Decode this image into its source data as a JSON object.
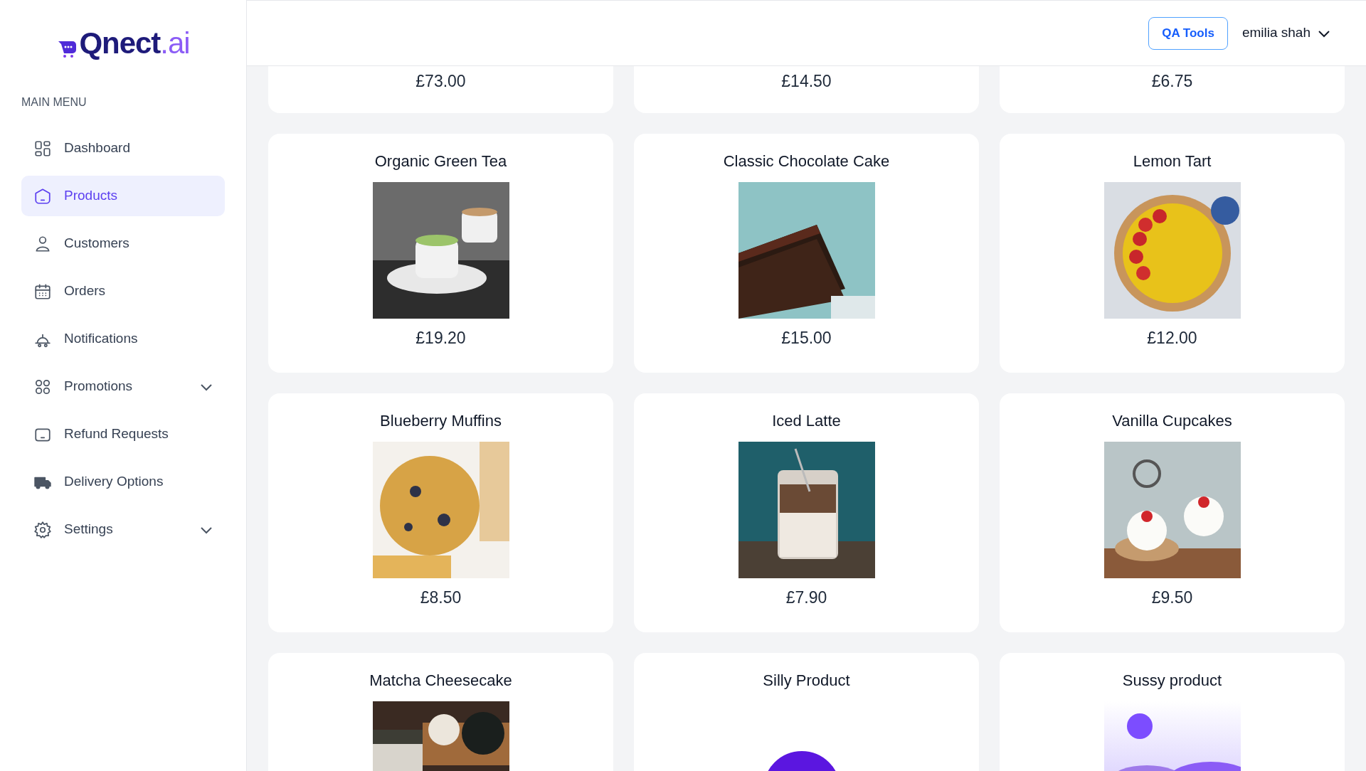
{
  "logo": {
    "text": "Qnect",
    "suffix": ".ai"
  },
  "sidebar": {
    "heading": "MAIN MENU",
    "items": [
      {
        "label": "Dashboard",
        "selected": false,
        "expandable": false
      },
      {
        "label": "Products",
        "selected": true,
        "expandable": false
      },
      {
        "label": "Customers",
        "selected": false,
        "expandable": false
      },
      {
        "label": "Orders",
        "selected": false,
        "expandable": false
      },
      {
        "label": "Notifications",
        "selected": false,
        "expandable": false
      },
      {
        "label": "Promotions",
        "selected": false,
        "expandable": true
      },
      {
        "label": "Refund Requests",
        "selected": false,
        "expandable": false
      },
      {
        "label": "Delivery Options",
        "selected": false,
        "expandable": false
      },
      {
        "label": "Settings",
        "selected": false,
        "expandable": true
      }
    ]
  },
  "header": {
    "button": "QA Tools",
    "user": "emilia shah"
  },
  "products": [
    {
      "price": "£73.00"
    },
    {
      "price": "£14.50"
    },
    {
      "price": "£6.75"
    },
    {
      "name": "Organic Green Tea",
      "kind": "photo",
      "price": "£19.20"
    },
    {
      "name": "Classic Chocolate Cake",
      "kind": "photo",
      "price": "£15.00"
    },
    {
      "name": "Lemon Tart",
      "kind": "photo",
      "price": "£12.00"
    },
    {
      "name": "Blueberry Muffins",
      "kind": "photo",
      "price": "£8.50"
    },
    {
      "name": "Iced Latte",
      "kind": "photo",
      "price": "£7.90"
    },
    {
      "name": "Vanilla Cupcakes",
      "kind": "photo",
      "price": "£9.50"
    },
    {
      "name": "Matcha Cheesecake",
      "kind": "photo"
    },
    {
      "name": "Silly Product",
      "kind": "logo"
    },
    {
      "name": "Sussy product",
      "kind": "placeholder"
    }
  ]
}
